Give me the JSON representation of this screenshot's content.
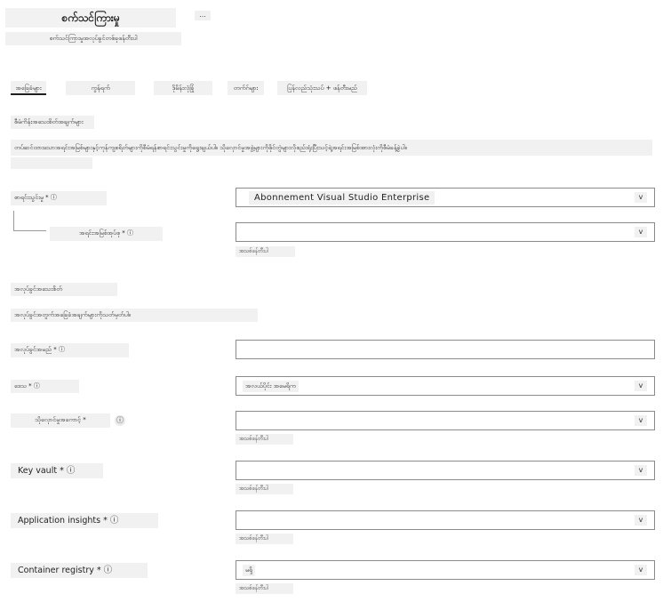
{
  "header": {
    "title": "စက်သင်ကြားမှု",
    "more_label": "...",
    "subtitle": "စက်သင်ကြားမှုအလုပ်ခွင်တစ်ခုဖန်တီးပါ"
  },
  "tabs": [
    {
      "label": "အခြေခံများ",
      "active": true
    },
    {
      "label": "ကွန်ရက်",
      "active": false
    },
    {
      "label": "ဒိုမိန်းလုံခြုံ",
      "active": false
    },
    {
      "label": "တက်ဂ်များ",
      "active": false
    },
    {
      "label": "ပြန်လည်သုံးသပ် + ဖန်တီးမည်",
      "active": false
    }
  ],
  "project": {
    "heading": "စီမံကိန်းအသေးစိတ်အချက်များ",
    "description": "တပ်ဆင်ထားသောအရင်းအမြစ်များနှင့်ကုန်ကျစရိတ်များကိုစီမံရန်စာရင်းသွင်းမှုကိုရွေးချယ်ပါ။ သိုလှောင်မှုအဖွဲ့များကိုဖိုင်တွဲများလိုစည်းရုံးပြီးသင့်ရဲ့အရင်းအမြစ်အားလုံးကိုစီမံခန့်ခွဲပါ။",
    "description_extra": ""
  },
  "subscription": {
    "label": "စာရင်းသွင်းမှု * ⓘ",
    "value": "Abonnement Visual Studio Enterprise",
    "chevron": "v"
  },
  "resource_group": {
    "label": "အရင်းအမြစ်အုပ်စု * ⓘ",
    "value": "",
    "chevron": "v",
    "create_new": "အသစ်ဖန်တီးပါ"
  },
  "workspace": {
    "heading": "အလုပ်ခွင်အသေးစိတ်",
    "description": "အလုပ်ခွင်အတွက်အခြေခံအချက်များကိုသတ်မှတ်ပါ။"
  },
  "workspace_name": {
    "label": "အလုပ်ခွင်အမည် * ⓘ",
    "value": ""
  },
  "region": {
    "label": "ဒေသ * ⓘ",
    "value": "အလယ်ပိုင်း အမေရိက",
    "chevron": "v"
  },
  "storage": {
    "label": "သိုလှောင်မှုအကောင့် *",
    "info": "ⓘ",
    "value": "",
    "chevron": "v",
    "create_new": "အသစ်ဖန်တီးပါ"
  },
  "key_vault": {
    "label": "Key vault * ⓘ",
    "value": "",
    "chevron": "v",
    "create_new": "အသစ်ဖန်တီးပါ"
  },
  "app_insights": {
    "label": "Application insights * ⓘ",
    "value": "",
    "chevron": "v",
    "create_new": "အသစ်ဖန်တီးပါ"
  },
  "container_registry": {
    "label": "Container registry * ⓘ",
    "value": "မရှိ",
    "chevron": "v",
    "create_new": "အသစ်ဖန်တီးပါ"
  }
}
